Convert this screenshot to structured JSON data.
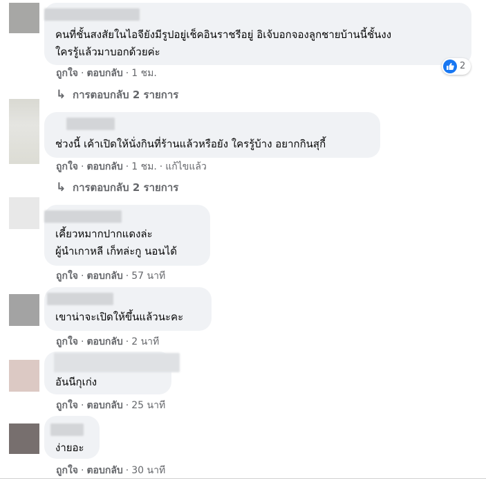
{
  "comments": [
    {
      "lines": [
        "คนที่ชั้นสงสัยในไอจียังมีรูปอยู่เช็คอินราชรีอยู่ อิเจ้บอกจองลูกชายบ้านนี้ชั้นงง",
        "ใครรู้แล้วมาบอกด้วยค่ะ"
      ],
      "like": "ถูกใจ",
      "reply": "ตอบกลับ",
      "time": "1 ชม.",
      "reaction_count": "2",
      "replies_label": "การตอบกลับ 2 รายการ"
    },
    {
      "lines": [
        "ช่วงนี้ เค้าเปิดให้นั่งกินที่ร้านแล้วหรือยัง ใครรู้บ้าง อยากกินสุกี้"
      ],
      "like": "ถูกใจ",
      "reply": "ตอบกลับ",
      "time": "1 ชม.",
      "edited": "แก้ไขแล้ว",
      "replies_label": "การตอบกลับ 2 รายการ"
    },
    {
      "lines": [
        "เคี้ยวหมากปากแดงล่ะ",
        "ผู้นำเกาหลี เก็ทล่ะกู นอนได้"
      ],
      "like": "ถูกใจ",
      "reply": "ตอบกลับ",
      "time": "57 นาที"
    },
    {
      "lines": [
        "เขาน่าจะเปิดให้ขึ้นแล้วนะคะ"
      ],
      "like": "ถูกใจ",
      "reply": "ตอบกลับ",
      "time": "2 นาที"
    },
    {
      "lines": [
        "อันนีกุเก่ง"
      ],
      "like": "ถูกใจ",
      "reply": "ตอบกลับ",
      "time": "25 นาที"
    },
    {
      "lines": [
        "ง่ายอะ"
      ],
      "like": "ถูกใจ",
      "reply": "ตอบกลับ",
      "time": "30 นาที"
    }
  ],
  "icons": {
    "reaction": "like-thumb-icon",
    "replies_arrow": "reply-arrow-icon"
  },
  "colors": {
    "bubble": "#f0f2f5",
    "secondary_text": "#65676b",
    "like_blue": "#1877f2"
  }
}
